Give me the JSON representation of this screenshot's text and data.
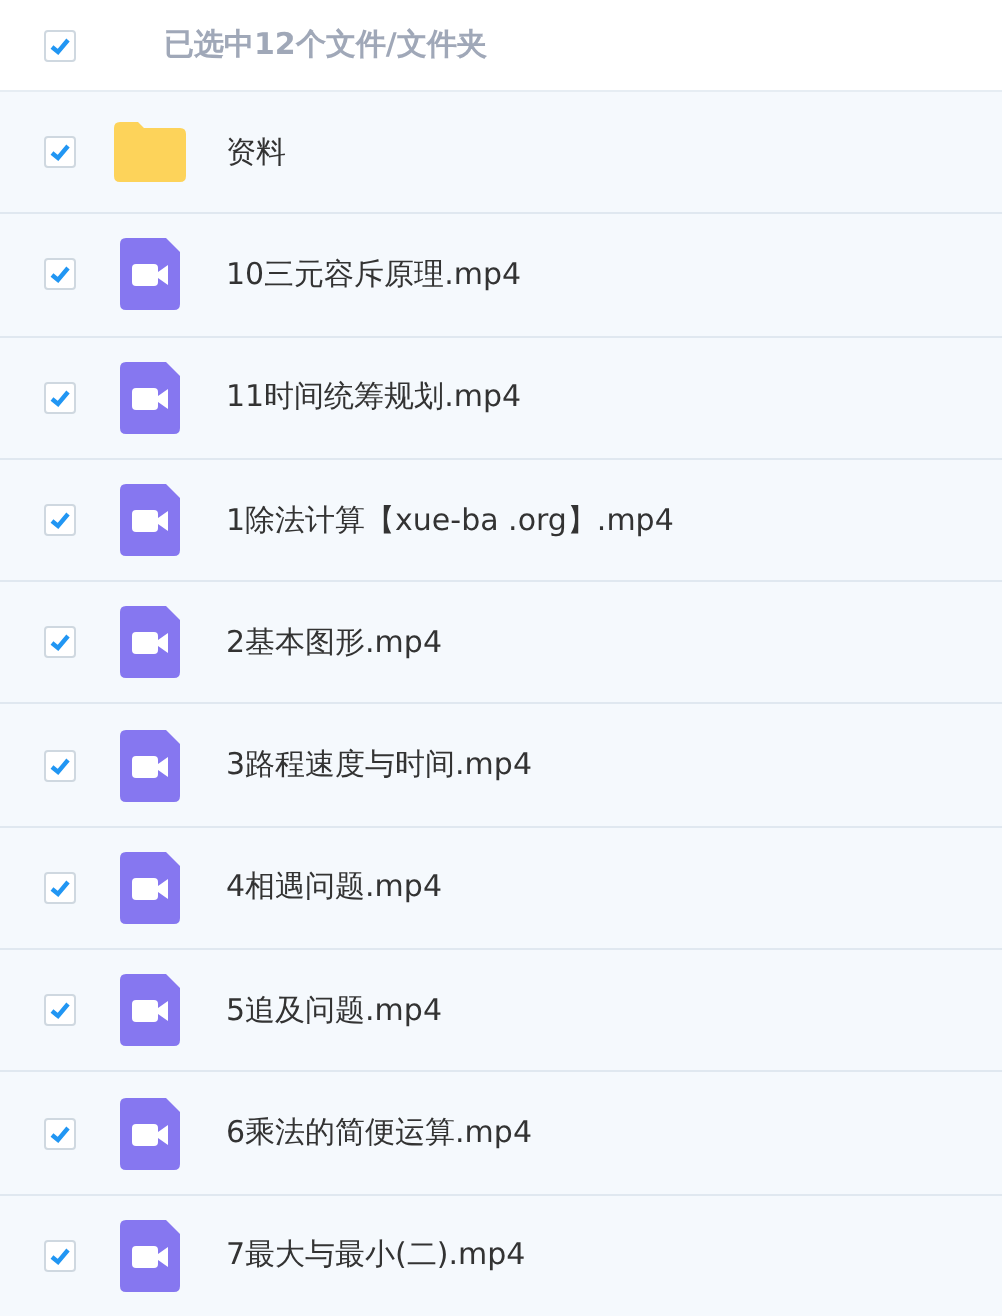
{
  "header": {
    "checked": true,
    "label": "已选中12个文件/文件夹"
  },
  "files": [
    {
      "kind": "folder",
      "name": "资料",
      "checked": true
    },
    {
      "kind": "video",
      "name": "10三元容斥原理.mp4",
      "checked": true
    },
    {
      "kind": "video",
      "name": "11时间统筹规划.mp4",
      "checked": true
    },
    {
      "kind": "video",
      "name": "1除法计算【xue-ba .org】.mp4",
      "checked": true
    },
    {
      "kind": "video",
      "name": "2基本图形.mp4",
      "checked": true
    },
    {
      "kind": "video",
      "name": "3路程速度与时间.mp4",
      "checked": true
    },
    {
      "kind": "video",
      "name": "4相遇问题.mp4",
      "checked": true
    },
    {
      "kind": "video",
      "name": "5追及问题.mp4",
      "checked": true
    },
    {
      "kind": "video",
      "name": "6乘法的简便运算.mp4",
      "checked": true
    },
    {
      "kind": "video",
      "name": "7最大与最小(二).mp4",
      "checked": true
    }
  ]
}
